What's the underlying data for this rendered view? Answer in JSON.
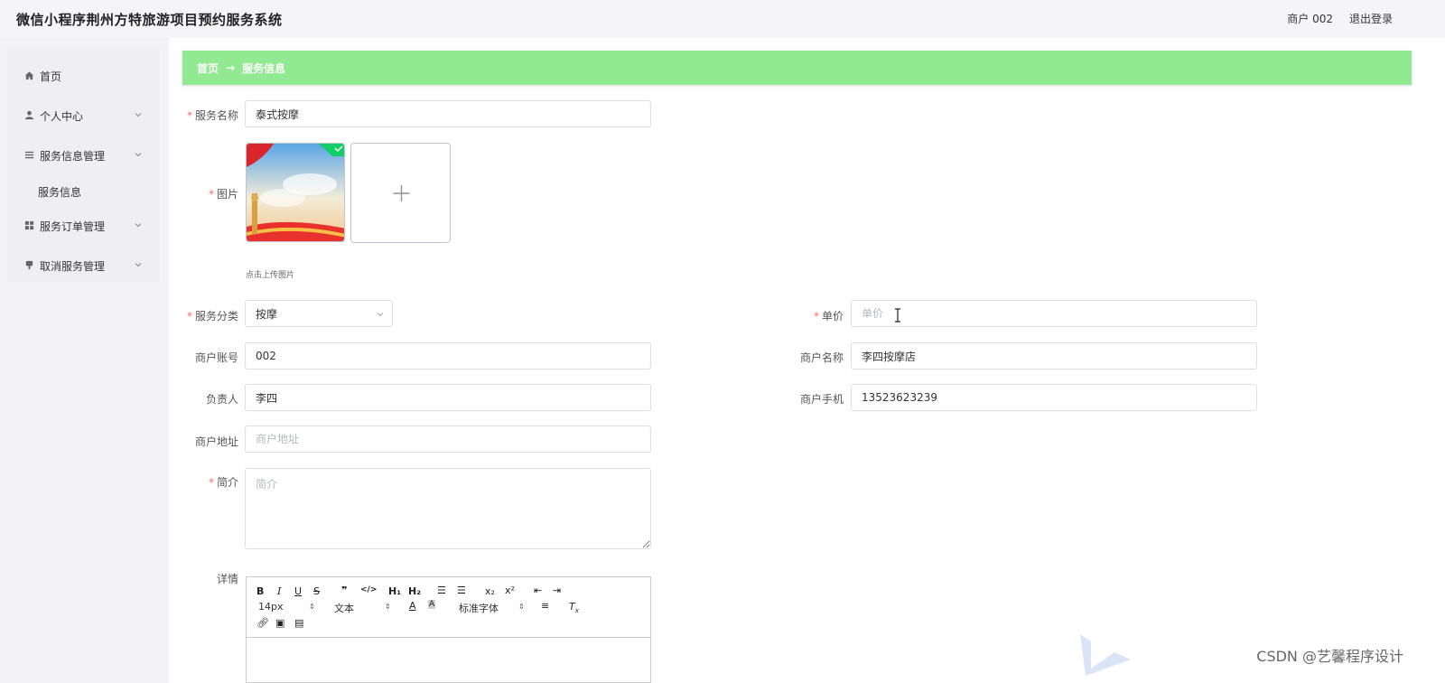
{
  "app": {
    "title": "微信小程序荆州方特旅游项目预约服务系统"
  },
  "top_right": {
    "user_label": "商户 002",
    "logout_label": "退出登录"
  },
  "sidebar": {
    "items": [
      {
        "label": "首页",
        "icon": "home-icon"
      },
      {
        "label": "个人中心",
        "icon": "user-icon"
      },
      {
        "label": "服务信息管理",
        "icon": "list-icon"
      },
      {
        "label": "服务订单管理",
        "icon": "grid-icon"
      },
      {
        "label": "取消服务管理",
        "icon": "pin-icon"
      }
    ],
    "sub_item": "服务信息"
  },
  "breadcrumb": {
    "home": "首页",
    "arrow": "→",
    "current": "服务信息"
  },
  "form": {
    "service_name": {
      "label": "服务名称",
      "value": "泰式按摩"
    },
    "image": {
      "label": "图片",
      "hint": "点击上传图片"
    },
    "category": {
      "label": "服务分类",
      "value": "按摩"
    },
    "price": {
      "label": "单价",
      "placeholder": "单价"
    },
    "merchant_account": {
      "label": "商户账号",
      "value": "002"
    },
    "merchant_name": {
      "label": "商户名称",
      "value": "李四按摩店"
    },
    "owner": {
      "label": "负责人",
      "value": "李四"
    },
    "merchant_phone": {
      "label": "商户手机",
      "value": "13523623239"
    },
    "merchant_address": {
      "label": "商户地址",
      "placeholder": "商户地址"
    },
    "intro": {
      "label": "简介",
      "placeholder": "简介"
    },
    "details": {
      "label": "详情"
    }
  },
  "editor": {
    "font_size": "14px",
    "block_type": "文本",
    "font_family": "标准字体"
  },
  "watermark": "CSDN @艺馨程序设计",
  "colors": {
    "breadcrumb_bg": "#91ea91",
    "required": "#f56c6c",
    "success": "#13ce66"
  }
}
